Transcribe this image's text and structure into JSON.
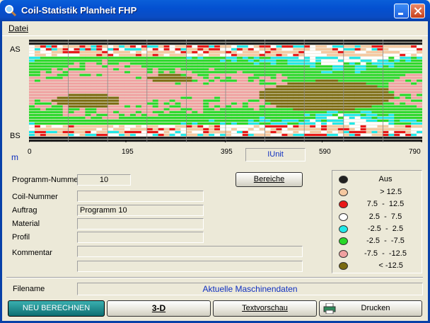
{
  "window": {
    "title": "Coil-Statistik Planheit FHP"
  },
  "menu": {
    "file": "Datei"
  },
  "plot": {
    "label_top": "AS",
    "label_bottom": "BS",
    "x_unit": "m",
    "x_ticks": [
      "0",
      "195",
      "395",
      "590",
      "790"
    ],
    "unit_box": "IUnit"
  },
  "form": {
    "programm_nummer_label": "Programm-Nummer",
    "programm_nummer_value": "10",
    "coil_nummer_label": "Coil-Nummer",
    "coil_nummer_value": "",
    "auftrag_label": "Auftrag",
    "auftrag_value": "Programm 10",
    "material_label": "Material",
    "material_value": "",
    "profil_label": "Profil",
    "profil_value": "",
    "kommentar_label": "Kommentar",
    "kommentar_value_1": "",
    "kommentar_value_2": "",
    "filename_label": "Filename",
    "filename_value": "Aktuelle Maschinendaten"
  },
  "buttons": {
    "bereiche": "Bereiche",
    "neu_berechnen": "NEU BERECHNEN",
    "three_d": "3-D",
    "textvorschau": "Textvorschau",
    "drucken": "Drucken"
  },
  "legend": [
    {
      "label": "Aus",
      "color": "#202020"
    },
    {
      "label": "     > 12.5",
      "color": "#F5C8A0"
    },
    {
      "label": "7.5  -  12.5",
      "color": "#E81818"
    },
    {
      "label": "2.5  -  7.5",
      "color": "#FFFFFF"
    },
    {
      "label": "-2.5  -  2.5",
      "color": "#20E8E8"
    },
    {
      "label": "-2.5  -  -7.5",
      "color": "#28D828"
    },
    {
      "label": "-7.5  -  -12.5",
      "color": "#F0A0A0"
    },
    {
      "label": "     < -12.5",
      "color": "#7A6A10"
    }
  ],
  "chart_data": {
    "type": "heatmap",
    "xlim": [
      0,
      790
    ],
    "x_ticks": [
      0,
      195,
      395,
      590,
      790
    ],
    "y_labels": [
      "AS",
      "BS"
    ],
    "category_colors": {
      "aus": "#202020",
      "gt_12_5": "#F5C8A0",
      "7_5_to_12_5": "#E81818",
      "2_5_to_7_5": "#FFFFFF",
      "m2_5_to_2_5": "#20E8E8",
      "m2_5_to_m7_5": "#28D828",
      "m7_5_to_m12_5": "#F0A0A0",
      "lt_m12_5": "#7A6A10"
    }
  }
}
